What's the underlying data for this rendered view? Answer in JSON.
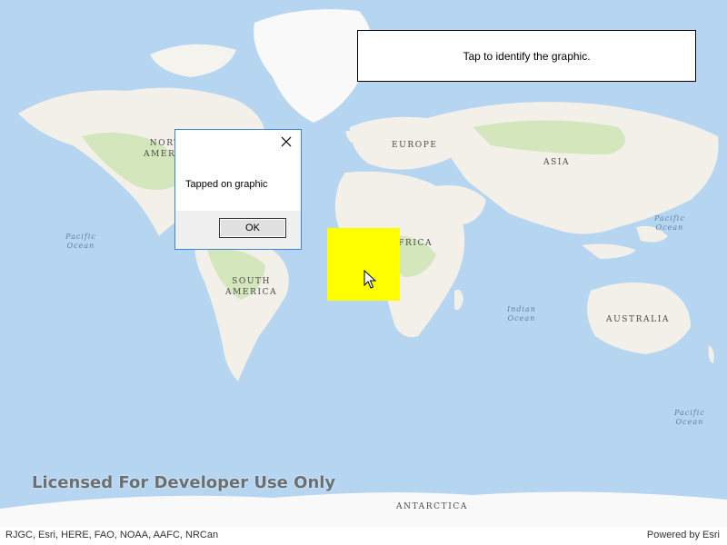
{
  "instructions": {
    "text": "Tap to identify the graphic."
  },
  "dialog": {
    "message": "Tapped on graphic",
    "ok_label": "OK",
    "close_icon": "close-icon"
  },
  "map": {
    "basemap": "topographic",
    "colors": {
      "ocean": "#b5d5f0",
      "land": "#f2f0e8",
      "green": "#d3e6bc",
      "ice": "#f9f9f9",
      "graphic": "#ffff00"
    },
    "continent_labels": {
      "north_america": [
        "NORTH",
        "AMERICA"
      ],
      "south_america": [
        "SOUTH",
        "AMERICA"
      ],
      "europe": "EUROPE",
      "asia": "ASIA",
      "africa": "AFRICA",
      "australia": "AUSTRALIA",
      "antarctica": "ANTARCTICA"
    },
    "ocean_labels": {
      "pacific_west": [
        "Pacific",
        "Ocean"
      ],
      "pacific_east": [
        "Pacific",
        "Ocean"
      ],
      "pacific_east_lower": [
        "Pacific",
        "Ocean"
      ],
      "indian": [
        "Indian",
        "Ocean"
      ]
    }
  },
  "watermark": "Licensed For Developer Use Only",
  "attribution": {
    "left": "RJGC, Esri, HERE, FAO, NOAA, AAFC, NRCan",
    "right": "Powered by Esri"
  }
}
